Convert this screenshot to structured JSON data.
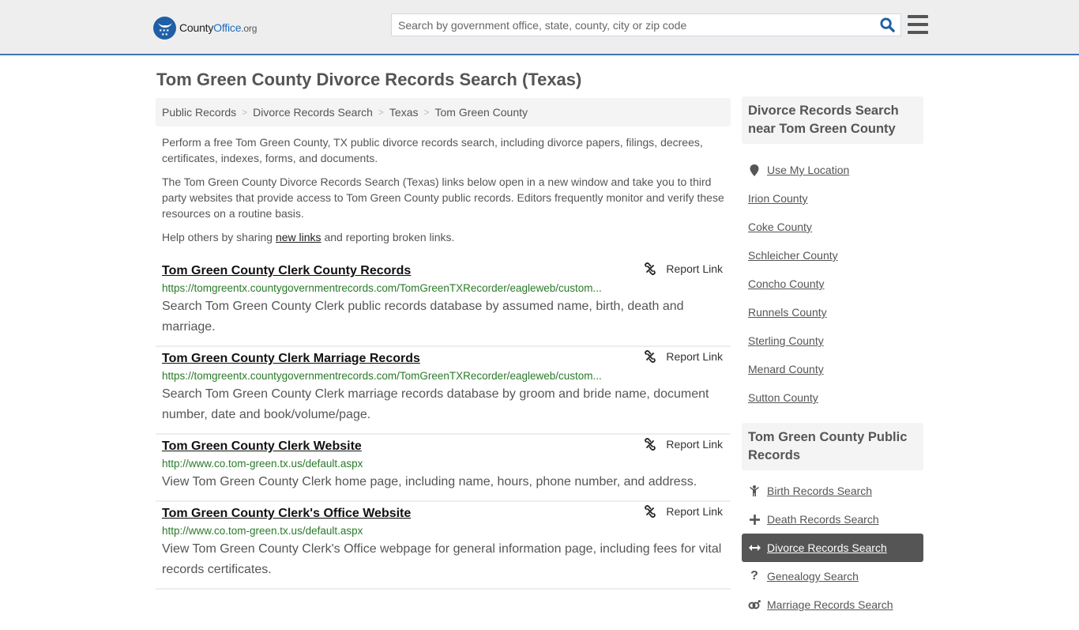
{
  "header": {
    "logo": {
      "brand_part1": "County",
      "brand_part2": "Office",
      "brand_tld": ".org"
    },
    "search": {
      "placeholder": "Search by government office, state, county, city or zip code",
      "value": ""
    },
    "colors": {
      "accent": "#3b78b0",
      "brand_blue": "#1f5fa6"
    }
  },
  "page": {
    "title": "Tom Green County Divorce Records Search (Texas)",
    "breadcrumb": [
      "Public Records",
      "Divorce Records Search",
      "Texas",
      "Tom Green County"
    ],
    "intro": {
      "p1": "Perform a free Tom Green County, TX public divorce records search, including divorce papers, filings, decrees, certificates, indexes, forms, and documents.",
      "p2": "The Tom Green County Divorce Records Search (Texas) links below open in a new window and take you to third party websites that provide access to Tom Green County public records. Editors frequently monitor and verify these resources on a routine basis.",
      "p3_before": "Help others by sharing ",
      "p3_link": "new links",
      "p3_after": " and reporting broken links."
    },
    "report_label": "Report Link",
    "results": [
      {
        "title": "Tom Green County Clerk County Records",
        "url": "https://tomgreentx.countygovernmentrecords.com/TomGreenTXRecorder/eagleweb/custom...",
        "description": "Search Tom Green County Clerk public records database by assumed name, birth, death and marriage."
      },
      {
        "title": "Tom Green County Clerk Marriage Records",
        "url": "https://tomgreentx.countygovernmentrecords.com/TomGreenTXRecorder/eagleweb/custom...",
        "description": "Search Tom Green County Clerk marriage records database by groom and bride name, document number, date and book/volume/page."
      },
      {
        "title": "Tom Green County Clerk Website",
        "url": "http://www.co.tom-green.tx.us/default.aspx",
        "description": "View Tom Green County Clerk home page, including name, hours, phone number, and address."
      },
      {
        "title": "Tom Green County Clerk's Office Website",
        "url": "http://www.co.tom-green.tx.us/default.aspx",
        "description": "View Tom Green County Clerk's Office webpage for general information page, including fees for vital records certificates."
      }
    ]
  },
  "sidebar": {
    "nearby": {
      "heading": "Divorce Records Search near Tom Green County",
      "use_location": "Use My Location",
      "counties": [
        "Irion County",
        "Coke County",
        "Schleicher County",
        "Concho County",
        "Runnels County",
        "Sterling County",
        "Menard County",
        "Sutton County"
      ]
    },
    "public_records": {
      "heading": "Tom Green County Public Records",
      "items": [
        {
          "label": "Birth Records Search",
          "icon": "child-icon",
          "active": false
        },
        {
          "label": "Death Records Search",
          "icon": "plus-icon",
          "active": false
        },
        {
          "label": "Divorce Records Search",
          "icon": "arrows-horizontal-icon",
          "active": true
        },
        {
          "label": "Genealogy Search",
          "icon": "question-icon",
          "active": false
        },
        {
          "label": "Marriage Records Search",
          "icon": "marriage-icon",
          "active": false
        }
      ]
    }
  }
}
